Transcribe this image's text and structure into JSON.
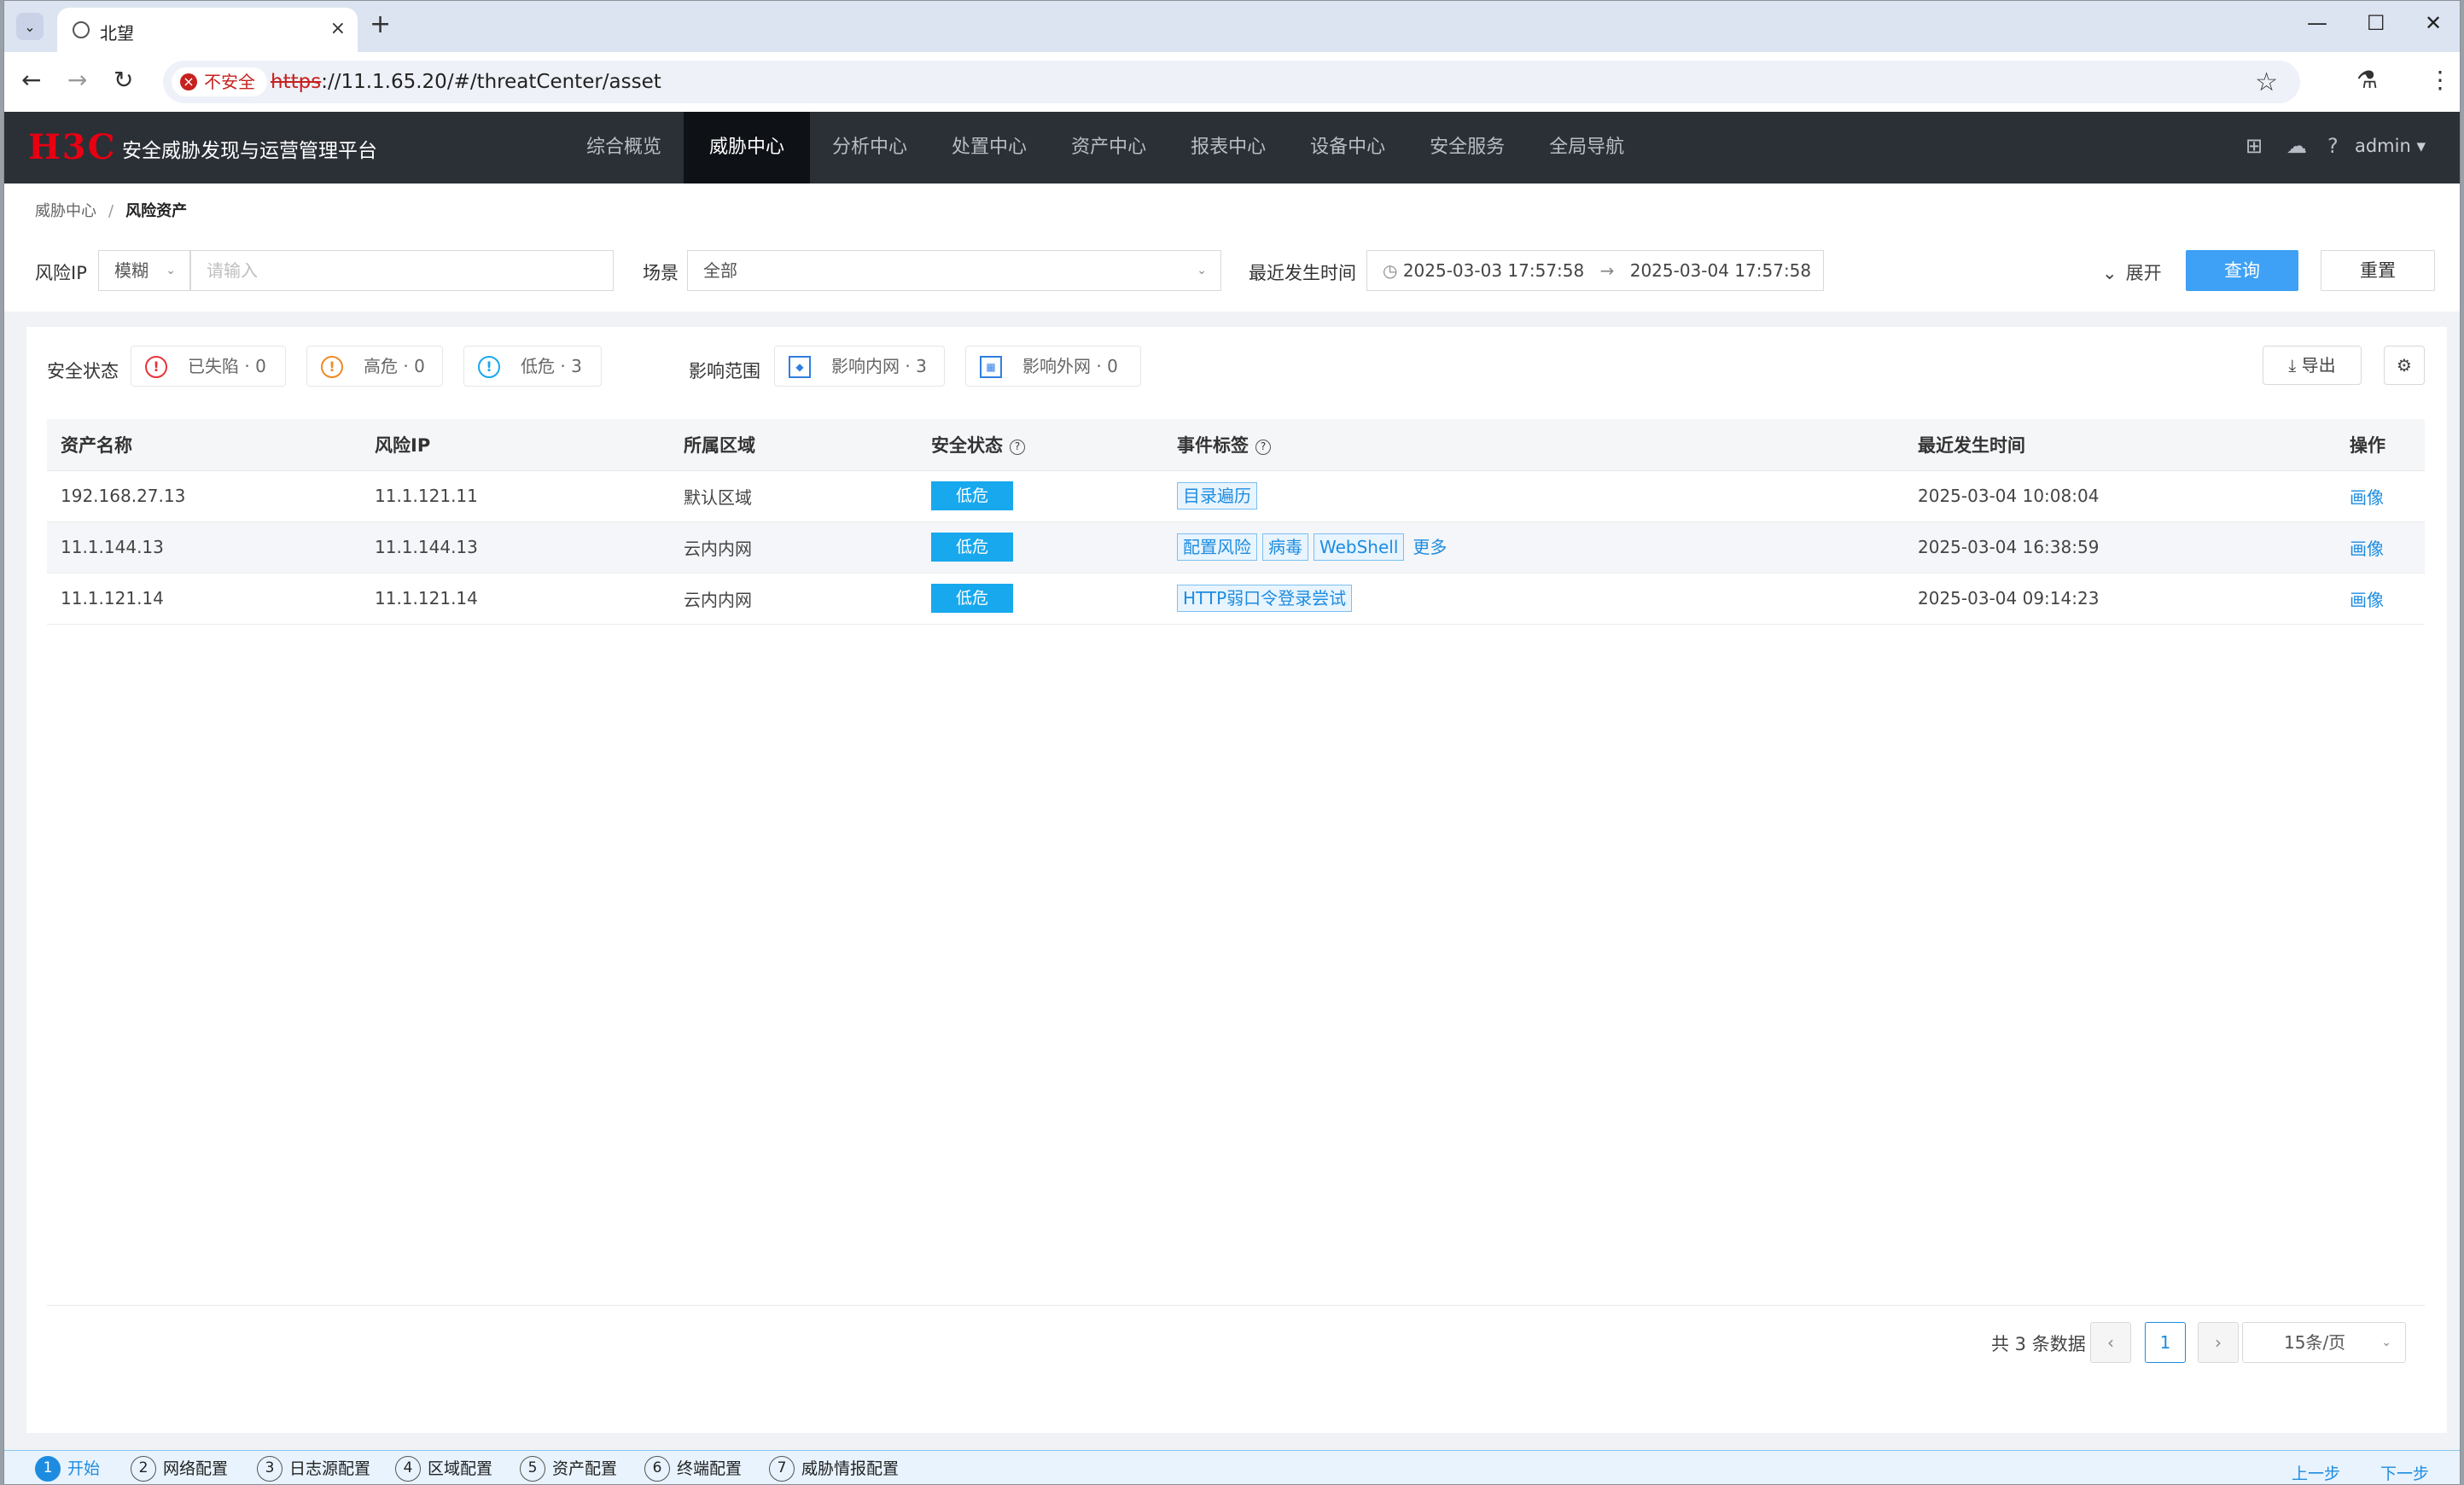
{
  "browser": {
    "tab_title": "北望",
    "insecure_label": "不安全",
    "url_scheme": "https",
    "url_rest": "://11.1.65.20/#/threatCenter/asset"
  },
  "app": {
    "logo": "H3C",
    "title": "安全威胁发现与运营管理平台",
    "nav": [
      "综合概览",
      "威胁中心",
      "分析中心",
      "处置中心",
      "资产中心",
      "报表中心",
      "设备中心",
      "安全服务",
      "全局导航"
    ],
    "active_nav": "威胁中心",
    "user": "admin"
  },
  "breadcrumb": {
    "parent": "威胁中心",
    "sep": "/",
    "current": "风险资产"
  },
  "filters": {
    "risk_ip_label": "风险IP",
    "match_mode": "模糊",
    "ip_placeholder": "请输入",
    "scene_label": "场景",
    "scene_value": "全部",
    "time_label": "最近发生时间",
    "time_start": "2025-03-03 17:57:58",
    "time_end": "2025-03-04 17:57:58",
    "expand_label": "展开",
    "query_button": "查询",
    "reset_button": "重置"
  },
  "stats": {
    "security_label": "安全状态",
    "compromised": {
      "label": "已失陷",
      "count": "0"
    },
    "high": {
      "label": "高危",
      "count": "0"
    },
    "low": {
      "label": "低危",
      "count": "3"
    },
    "impact_label": "影响范围",
    "intranet": {
      "label": "影响内网",
      "count": "3"
    },
    "extranet": {
      "label": "影响外网",
      "count": "0"
    },
    "export_label": "导出"
  },
  "table": {
    "headers": [
      "资产名称",
      "风险IP",
      "所属区域",
      "安全状态",
      "事件标签",
      "最近发生时间",
      "操作"
    ],
    "rows": [
      {
        "name": "192.168.27.13",
        "ip": "11.1.121.11",
        "area": "默认区域",
        "status": "低危",
        "tags": [
          "目录遍历"
        ],
        "more": "",
        "time": "2025-03-04 10:08:04",
        "op": "画像"
      },
      {
        "name": "11.1.144.13",
        "ip": "11.1.144.13",
        "area": "云内内网",
        "status": "低危",
        "tags": [
          "配置风险",
          "病毒",
          "WebShell"
        ],
        "more": "更多",
        "time": "2025-03-04 16:38:59",
        "op": "画像"
      },
      {
        "name": "11.1.121.14",
        "ip": "11.1.121.14",
        "area": "云内内网",
        "status": "低危",
        "tags": [
          "HTTP弱口令登录尝试"
        ],
        "more": "",
        "time": "2025-03-04 09:14:23",
        "op": "画像"
      }
    ]
  },
  "pagination": {
    "total_text": "共 3 条数据",
    "current_page": "1",
    "page_size": "15条/页"
  },
  "wizard": {
    "steps": [
      {
        "num": "1",
        "label": "开始"
      },
      {
        "num": "2",
        "label": "网络配置"
      },
      {
        "num": "3",
        "label": "日志源配置"
      },
      {
        "num": "4",
        "label": "区域配置"
      },
      {
        "num": "5",
        "label": "资产配置"
      },
      {
        "num": "6",
        "label": "终端配置"
      },
      {
        "num": "7",
        "label": "威胁情报配置"
      }
    ],
    "prev": "上一步",
    "next": "下一步"
  },
  "colors": {
    "accent": "#1d8ce0",
    "query_button": "#3ea1f5",
    "header_bg": "#2b2f36",
    "logo_red": "#e60012",
    "badge_low": "#17a8ee"
  }
}
